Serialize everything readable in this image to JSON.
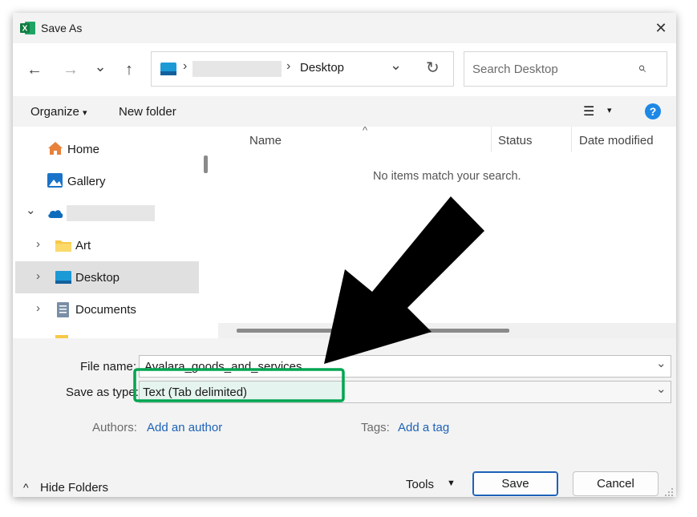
{
  "window": {
    "title": "Save As",
    "close_glyph": "✕"
  },
  "nav": {
    "back": "←",
    "forward": "→",
    "recent": "⌄",
    "up": "↑",
    "refresh": "↻"
  },
  "address": {
    "separator": "›",
    "current": "Desktop",
    "dropdown": "⌄"
  },
  "search": {
    "placeholder": "Search Desktop",
    "icon": "⌕"
  },
  "toolbar": {
    "organize": "Organize",
    "caret": "▾",
    "new_folder": "New folder",
    "view": "☰",
    "view_caret": "▾",
    "help": "?"
  },
  "sidebar": {
    "items": [
      {
        "label": "Home",
        "icon": "home-icon"
      },
      {
        "label": "Gallery",
        "icon": "gallery-icon"
      },
      {
        "label": "",
        "icon": "cloud-icon",
        "expanded": true
      },
      {
        "label": "Art",
        "icon": "folder-icon"
      },
      {
        "label": "Desktop",
        "icon": "desktop-folder-icon",
        "selected": true
      },
      {
        "label": "Documents",
        "icon": "documents-icon"
      }
    ],
    "expand_glyph": "›",
    "collapse_glyph": "⌄"
  },
  "file_list": {
    "columns": [
      "Name",
      "Status",
      "Date modified"
    ],
    "sort_glyph": "^",
    "empty_message": "No items match your search."
  },
  "form": {
    "file_name_label": "File name:",
    "file_name_value": "Avalara_goods_and_services",
    "save_as_type_label": "Save as type:",
    "save_as_type_value": "Text (Tab delimited)",
    "authors_label": "Authors:",
    "authors_link": "Add an author",
    "tags_label": "Tags:",
    "tags_link": "Add a tag",
    "dropdown_glyph": "⌄"
  },
  "footer": {
    "hide_folders": "Hide Folders",
    "hide_glyph": "^",
    "tools": "Tools",
    "tools_caret": "▼",
    "save": "Save",
    "cancel": "Cancel"
  },
  "colors": {
    "accent": "#1d62b8",
    "highlight": "#00a550",
    "help": "#1e88e5"
  }
}
